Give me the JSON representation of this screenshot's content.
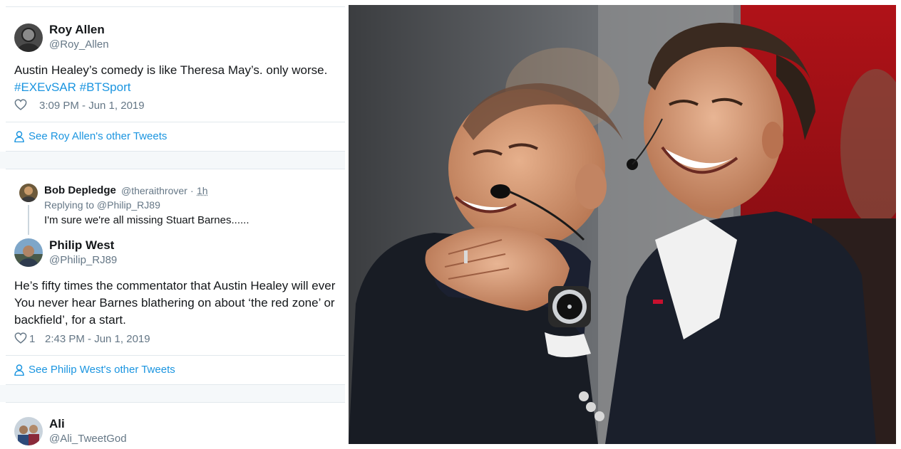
{
  "tweets": [
    {
      "name": "Roy Allen",
      "handle": "@Roy_Allen",
      "text_line1": "Austin Healey’s comedy is like Theresa May’s. only worse.",
      "hashtags": "#EXEvSAR #BTSport",
      "timestamp": "3:09 PM - Jun 1, 2019",
      "see_more": "See Roy Allen's other Tweets"
    },
    {
      "reply": {
        "name": "Bob Depledge",
        "handle": "@theraithrover",
        "time": "1h",
        "replying_to": "Replying to @Philip_RJ89",
        "text": "I'm sure we're all missing Stuart Barnes......"
      },
      "name": "Philip West",
      "handle": "@Philip_RJ89",
      "lines": [
        "He’s fifty times the commentator that Austin Healey will ever",
        "You never hear Barnes blathering on about ‘the red zone’ or",
        "backfield’, for a start."
      ],
      "likes": "1",
      "timestamp": "2:43 PM - Jun 1, 2019",
      "see_more": "See Philip West's other Tweets"
    },
    {
      "name": "Ali",
      "handle": "@Ali_TweetGod"
    }
  ],
  "icons": {
    "like": "heart-icon",
    "person": "person-icon"
  },
  "colors": {
    "link": "#1b95e0",
    "text": "#14171a",
    "muted": "#657786",
    "divider": "#e1e8ed"
  }
}
